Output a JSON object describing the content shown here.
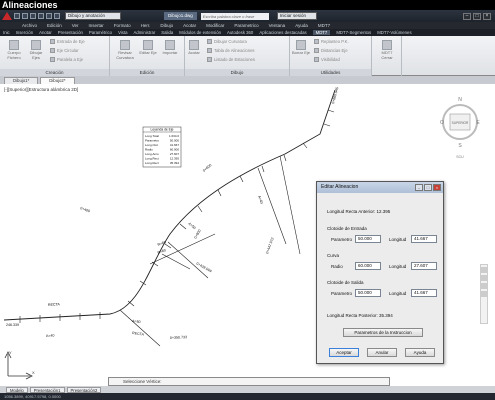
{
  "window": {
    "title": "Alineaciones",
    "drawing_title": "Dibujo1.dwg",
    "workspace": "Dibujo y anotación",
    "search_placeholder": "Escriba palabra clave o frase",
    "user_label": "Iniciar sesión"
  },
  "menubar": {
    "items": [
      "Archivo",
      "Edición",
      "Ver",
      "Insertar",
      "Formato",
      "Herr.",
      "Dibujo",
      "Acotar",
      "Modificar",
      "Parametrico",
      "Ventana",
      "Ayuda",
      "MDT7"
    ]
  },
  "ribbon_tabs": {
    "items": [
      "Inic",
      "Inserción",
      "Anotar",
      "Presentación",
      "Paramétrico",
      "Vista",
      "Administrar",
      "Salida",
      "Módulos de extensión",
      "Autodesk 360",
      "Aplicaciones destacadas",
      "MDT7",
      "MDT7-Segmentos",
      "MDT7-Volúmenes"
    ],
    "active_index": 11
  },
  "ribbon": {
    "creacion": {
      "title": "Creación",
      "buttons": [
        "Cuerpo Fichero",
        "Dibujar Ejes",
        "Crear Vértices"
      ],
      "rows": [
        "Entrada de Eje",
        "Eje Circular",
        "Paralela a Eje"
      ]
    },
    "edicion": {
      "title": "Edición",
      "buttons": [
        "Revisar Curvatura",
        "Editar Eje",
        "Importar"
      ],
      "rows": []
    },
    "dibujo": {
      "title": "Dibujo",
      "buttons": [
        "Acotar",
        "Cambiar",
        "Exportar"
      ],
      "rows": [
        "Dibujar Curvatura",
        "Tabla de Alineaciones",
        "Listado de Estaciones"
      ]
    },
    "utilidades": {
      "title": "Utilidades",
      "buttons": [
        "Borrar Eje"
      ],
      "rows": [
        "Replanteo P.K.",
        "Distancias Eje",
        "Visibilidad"
      ]
    },
    "extra": {
      "button": "MDT7 Cerrar"
    }
  },
  "doc_tabs": [
    "Dibujo1*",
    "Dibujo2*"
  ],
  "viewport_label": "[-][Superior][Estructura alámbrica 2D]",
  "drawing": {
    "legend_title": "Leyenda de Eje",
    "legend_rows": [
      [
        "Long.Total",
        "1.634.0"
      ],
      [
        "Parametro",
        "50.000"
      ],
      [
        "Long.Clot",
        "41.667"
      ],
      [
        "Radio",
        "60.000"
      ],
      [
        "Long.Arco",
        "27.607"
      ],
      [
        "Long.Rect",
        "12.395"
      ],
      [
        "Long.Rect",
        "35.394"
      ]
    ],
    "labels": [
      "RECTA",
      "RECTA",
      "A=50",
      "A=50",
      "R=60",
      "R=60",
      "A=40",
      "A=40",
      "0+400",
      "0+600",
      "0+800",
      "0+350.733",
      "0+439.099",
      "0+447.972",
      "246.339",
      "0+860.945"
    ]
  },
  "compass": {
    "north": "N",
    "south": "S",
    "east": "E",
    "west": "O",
    "cube_label": "SUPERIOR",
    "wcs": "SCU"
  },
  "dialog": {
    "title": "Editar Alineacion",
    "long_recta_anterior": "Longitud Recta Anterior: 12.395",
    "clotoide_entrada": "Clotoide de Entrada",
    "clotoide_salida": "Clotoide de Salida",
    "curva": "Curva",
    "parametro_label": "Parametro",
    "longitud_label": "Longitud",
    "radio_label": "Radio",
    "entrada_parametro": "50.000",
    "entrada_longitud": "41.667",
    "curva_radio": "60.000",
    "curva_longitud": "27.607",
    "salida_parametro": "50.000",
    "salida_longitud": "41.667",
    "long_recta_posterior": "Longitud Recta Posterior: 35.394",
    "instruction_button": "Parametros de la Instruccion",
    "aceptar": "Aceptar",
    "anular": "Anular",
    "ayuda": "Ayuda"
  },
  "layout_tabs": [
    "Modelo",
    "Presentación1",
    "Presentación2"
  ],
  "command_prompt": "Seleccione Vértice:",
  "status_text": "1056.3899, 40917.5798, 0.0000"
}
